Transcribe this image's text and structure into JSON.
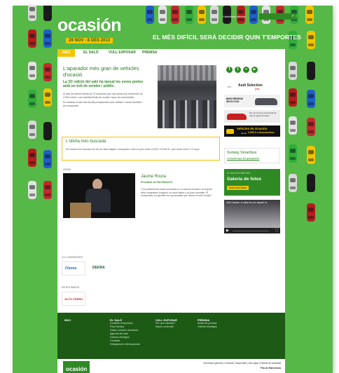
{
  "colors": {
    "background_green": "#56b847",
    "accent_yellow": "#f2c400",
    "brand_green": "#2f8a25",
    "footer_green": "#1c5a16"
  },
  "header": {
    "logo_text": "ocasión",
    "dates": "29 NOV - 8 DES 2013",
    "tagline": "EL MÉS DIFÍCIL SERÀ DECIDIR QUIN T'EMPORTES",
    "topbar_links": "Castellano  Idioma",
    "search_icon": "search-icon"
  },
  "nav": {
    "items": [
      "INICI",
      "EL SALÓ",
      "VULL EXPOSAR",
      "PREMSA"
    ]
  },
  "main": {
    "title": "L'aparador més gran de vehicles d'ocasió",
    "subtitle": "La 33ª edició del saló ha tancat les seves portes amb un èxit de vendes i públic.",
    "body1": "Al saló ha exhibit l'oferta de 73 expositors que han posat a la venda més de 3.500 cotxes i una varietat infinita de models i tipus de motocicletes.",
    "body2": "Es visitants el saló han decidit principalment pels utilitaris i cotxes familiars i per compactes.",
    "offer_title": "L'oferta més buscada",
    "offer_body": "Els cotxes més buscats són els de mida mitjana i compactes, amb un preu entre 10.000 i 15.000 €, i que tenen entre 3 i 5 anys.",
    "opinion_label": "OPINIÓ",
    "person_name": "Jaume Roura",
    "person_role": "President de FACONAUTO",
    "quote": "\"Les preferències estan centrades en el mercat d'ocasió i la majoria dels compradors busquen un cotxe fiable a un preu raonable. El consumidor vol aprofitar les oportunitats que ofereix el saló Ocasió.\"",
    "collab_label": "COL·LABORADORS",
    "sponsor1": "Fitema",
    "sponsor2": "DEKRA",
    "sponsor_label": "PATROCINADOR",
    "sponsor3": "AUTO FERRO"
  },
  "sidebar": {
    "social_icons": [
      "facebook-icon",
      "twitter-icon",
      "flickr-icon",
      "youtube-icon"
    ],
    "ad_audi": "Audi Selection",
    "ad_audi_sub": "plus",
    "ad_bmw": "BMW PREMIUM SELECTION",
    "ad_promo": "Per ser la teva oportunitat de triar la plaça d'ocasió",
    "ad_vehicles_title": "Vehicles de Ocasión",
    "ad_vehicles_desde": "desde",
    "ad_vehicles_price": "3.000 € a descubrirlos",
    "sorteig_title": "Sorteig Smartbox",
    "sorteig_link": "Consulta aquí els guanyadors",
    "gallery_label": "EL SALÓ EN IMATGES",
    "gallery_title": "Galeria de fotos",
    "gallery_button": "Veure les fotos",
    "video_title": "Saló Ocasión, el millor lloc per adquirir la..."
  },
  "footer": {
    "col1_head": "INICI",
    "col2_head": "EL SALÓ",
    "col2_items": [
      "Consells d'exposició",
      "Fitxa tècnica",
      "Dates, horaris i accessos",
      "Agenda del saló",
      "Galeria d'imatges",
      "Contacte",
      "Delegacions internacionals"
    ],
    "col3_head": "VULL EXPOSAR",
    "col3_items": [
      "Per què exposar?",
      "Espai comercial"
    ],
    "col4_head": "PREMSA",
    "col4_items": [
      "Notes de premsa",
      "Galeria d'imatges"
    ],
    "bottom_logo": "ocasión",
    "bottom_links": "Informació general | Contacte | Mapa Web | Avís legal | Política de privacitat",
    "bottom_org": "Fira de Barcelona"
  }
}
